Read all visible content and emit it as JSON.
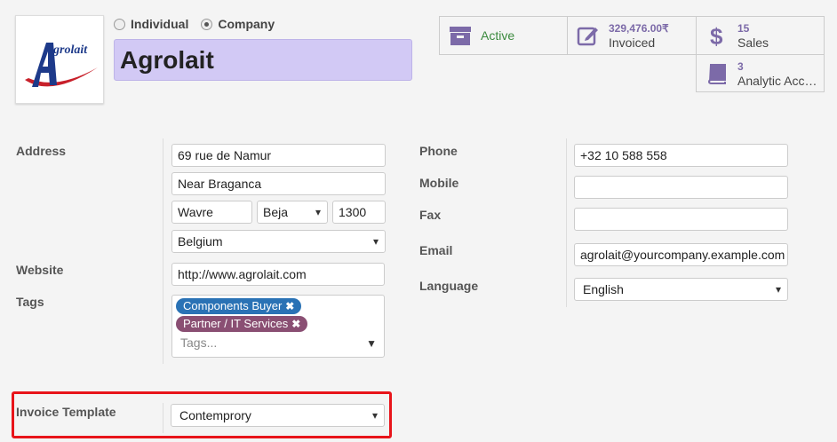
{
  "partner_type": {
    "options": [
      {
        "label": "Individual",
        "selected": false
      },
      {
        "label": "Company",
        "selected": true
      }
    ]
  },
  "logo": {
    "text": "grolait",
    "initial": "A"
  },
  "name": "Agrolait",
  "smart_buttons": {
    "active": {
      "label": "Active",
      "icon": "archive-icon",
      "color": "#3b8a3e"
    },
    "invoiced": {
      "value": "329,476.00₹",
      "label": "Invoiced",
      "icon": "edit-icon"
    },
    "sales": {
      "value": "15",
      "label": "Sales",
      "icon": "dollar-icon"
    },
    "analytic": {
      "value": "3",
      "label": "Analytic Acc…",
      "icon": "book-icon"
    }
  },
  "address": {
    "label": "Address",
    "street": "69 rue de Namur",
    "street2": "Near Braganca",
    "city": "Wavre",
    "state": "Beja",
    "zip": "1300",
    "country": "Belgium"
  },
  "website": {
    "label": "Website",
    "value": "http://www.agrolait.com"
  },
  "tags": {
    "label": "Tags",
    "items": [
      {
        "label": "Components Buyer",
        "color": "#2a72b5"
      },
      {
        "label": "Partner / IT Services",
        "color": "#8a4f73"
      }
    ],
    "placeholder": "Tags..."
  },
  "invoice_template": {
    "label": "Invoice Template",
    "value": "Contemprory"
  },
  "phone": {
    "label": "Phone",
    "value": "+32 10 588 558"
  },
  "mobile": {
    "label": "Mobile",
    "value": ""
  },
  "fax": {
    "label": "Fax",
    "value": ""
  },
  "email": {
    "label": "Email",
    "value": "agrolait@yourcompany.example.com"
  },
  "language": {
    "label": "Language",
    "value": "English"
  },
  "colors": {
    "accent": "#7c6aa8",
    "name_bg": "#d2c9f5",
    "highlight": "#e8141a"
  }
}
